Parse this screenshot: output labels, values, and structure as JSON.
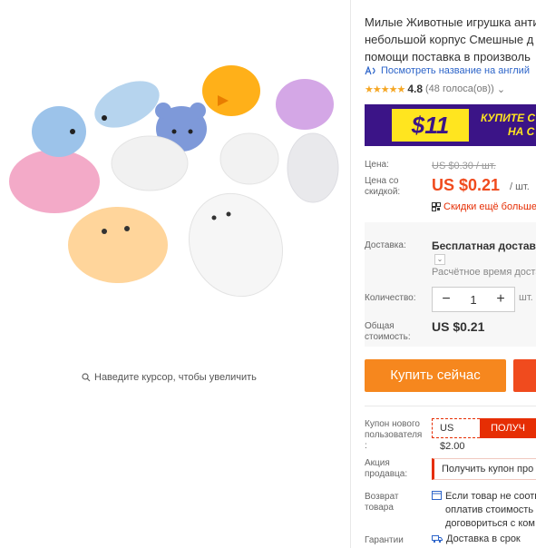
{
  "gallery": {
    "zoom_hint": "Наведите курсор, чтобы увеличить"
  },
  "product": {
    "title_lines": [
      "Милые Животные игрушка анти",
      "небольшой корпус Смешные д",
      "помощи поставка в произволь"
    ],
    "translate_link": "Посмотреть название на англий",
    "rating_value": "4.8",
    "rating_count": "(48 голоса(ов))",
    "stars": "★★★★★"
  },
  "banner": {
    "amount": "$11",
    "text_line1": "КУПИТЕ С",
    "text_line2": "НА С",
    "bg_color": "#3b1487",
    "accent_color": "#ffe51f"
  },
  "pricing": {
    "price_label": "Цена:",
    "old_price": "US $0.30 / шт.",
    "discount_label_line1": "Цена со",
    "discount_label_line2": "скидкой:",
    "price": "US $0.21",
    "unit": "/ шт.",
    "discount_link": "Скидки ещё больше",
    "accent_color": "#f04b1e"
  },
  "delivery": {
    "label": "Доставка:",
    "value": "Бесплатная доставка",
    "estimate": "Расчётное время доста"
  },
  "quantity": {
    "label": "Количество:",
    "minus": "−",
    "value": "1",
    "plus": "+",
    "unit": "шт."
  },
  "total": {
    "label_line1": "Общая",
    "label_line2": "стоимость:",
    "value": "US $0.21"
  },
  "actions": {
    "buy_now": "Купить сейчас"
  },
  "coupon": {
    "label_line1": "Купон нового",
    "label_line2": "пользователя",
    "label_line3": ":",
    "amount": "US $2.00",
    "button": "ПОЛУЧ"
  },
  "promo": {
    "label_line1": "Акция",
    "label_line2": "продавца:",
    "button": "Получить купон про"
  },
  "returns": {
    "label_line1": "Возврат",
    "label_line2": "товара",
    "line1": "Если товар не соотв",
    "line2": "оплатив стоимость",
    "line3": "договориться с ком"
  },
  "guarantee": {
    "label": "Гарантии",
    "value": "Доставка в срок"
  }
}
